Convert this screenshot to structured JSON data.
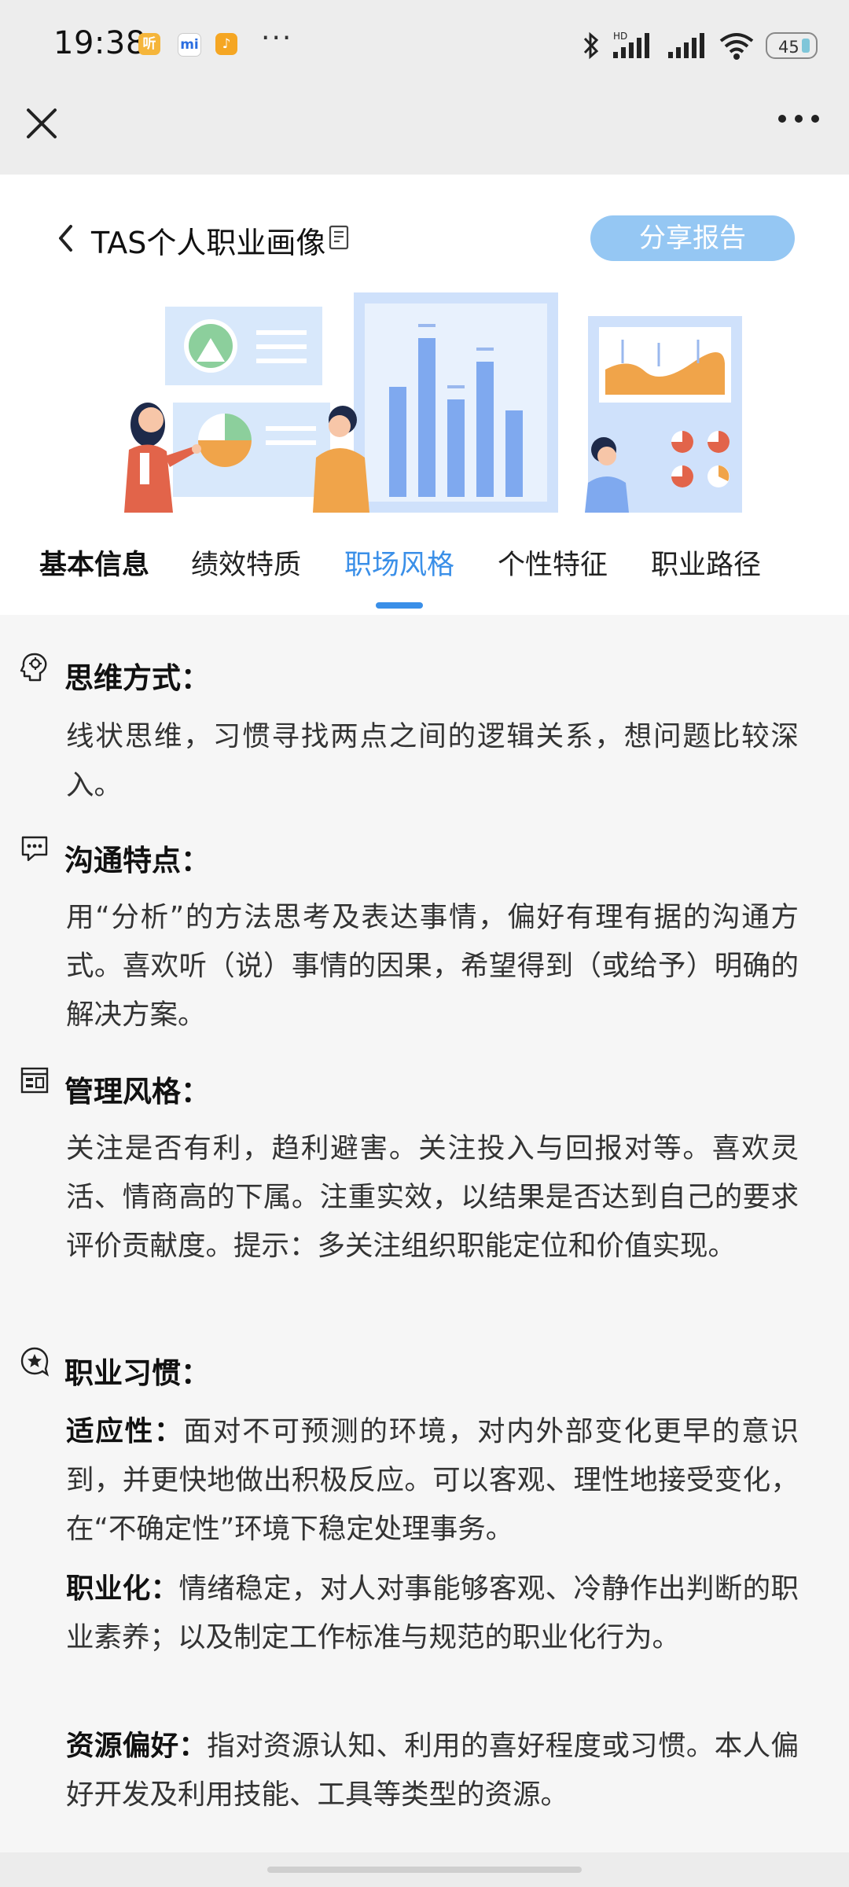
{
  "status_bar": {
    "time": "19:38",
    "app_icons": [
      "听",
      "mi",
      "♪"
    ],
    "more": "···",
    "network_label": "HD",
    "battery": "45"
  },
  "header": {
    "title": "TAS个人职业画像",
    "share_label": "分享报告"
  },
  "tabs": [
    {
      "label": "基本信息"
    },
    {
      "label": "绩效特质"
    },
    {
      "label": "职场风格"
    },
    {
      "label": "个性特征"
    },
    {
      "label": "职业路径"
    }
  ],
  "sections": {
    "thinking": {
      "title": "思维方式：",
      "text": "线状思维，习惯寻找两点之间的逻辑关系，想问题比较深入。"
    },
    "communication": {
      "title": "沟通特点：",
      "text": "用“分析”的方法思考及表达事情，偏好有理有据的沟通方式。喜欢听（说）事情的因果，希望得到（或给予）明确的解决方案。"
    },
    "management": {
      "title": "管理风格：",
      "text": "关注是否有利，趋利避害。关注投入与回报对等。喜欢灵活、情商高的下属。注重实效，以结果是否达到自己的要求评价贡献度。提示：多关注组织职能定位和价值实现。"
    },
    "habits": {
      "title": "职业习惯：",
      "items": [
        {
          "label": "适应性：",
          "text": "面对不可预测的环境，对内外部变化更早的意识到，并更快地做出积极反应。可以客观、理性地接受变化，在“不确定性”环境下稳定处理事务。"
        },
        {
          "label": "职业化：",
          "text": "情绪稳定，对人对事能够客观、冷静作出判断的职业素养；以及制定工作标准与规范的职业化行为。"
        },
        {
          "label": "资源偏好：",
          "text": "指对资源认知、利用的喜好程度或习惯。本人偏好开发及利用技能、工具等类型的资源。"
        }
      ]
    }
  },
  "colors": {
    "accent": "#3a8fe8",
    "share_button": "#95c7f3",
    "page_bg": "#f6f6f6"
  }
}
